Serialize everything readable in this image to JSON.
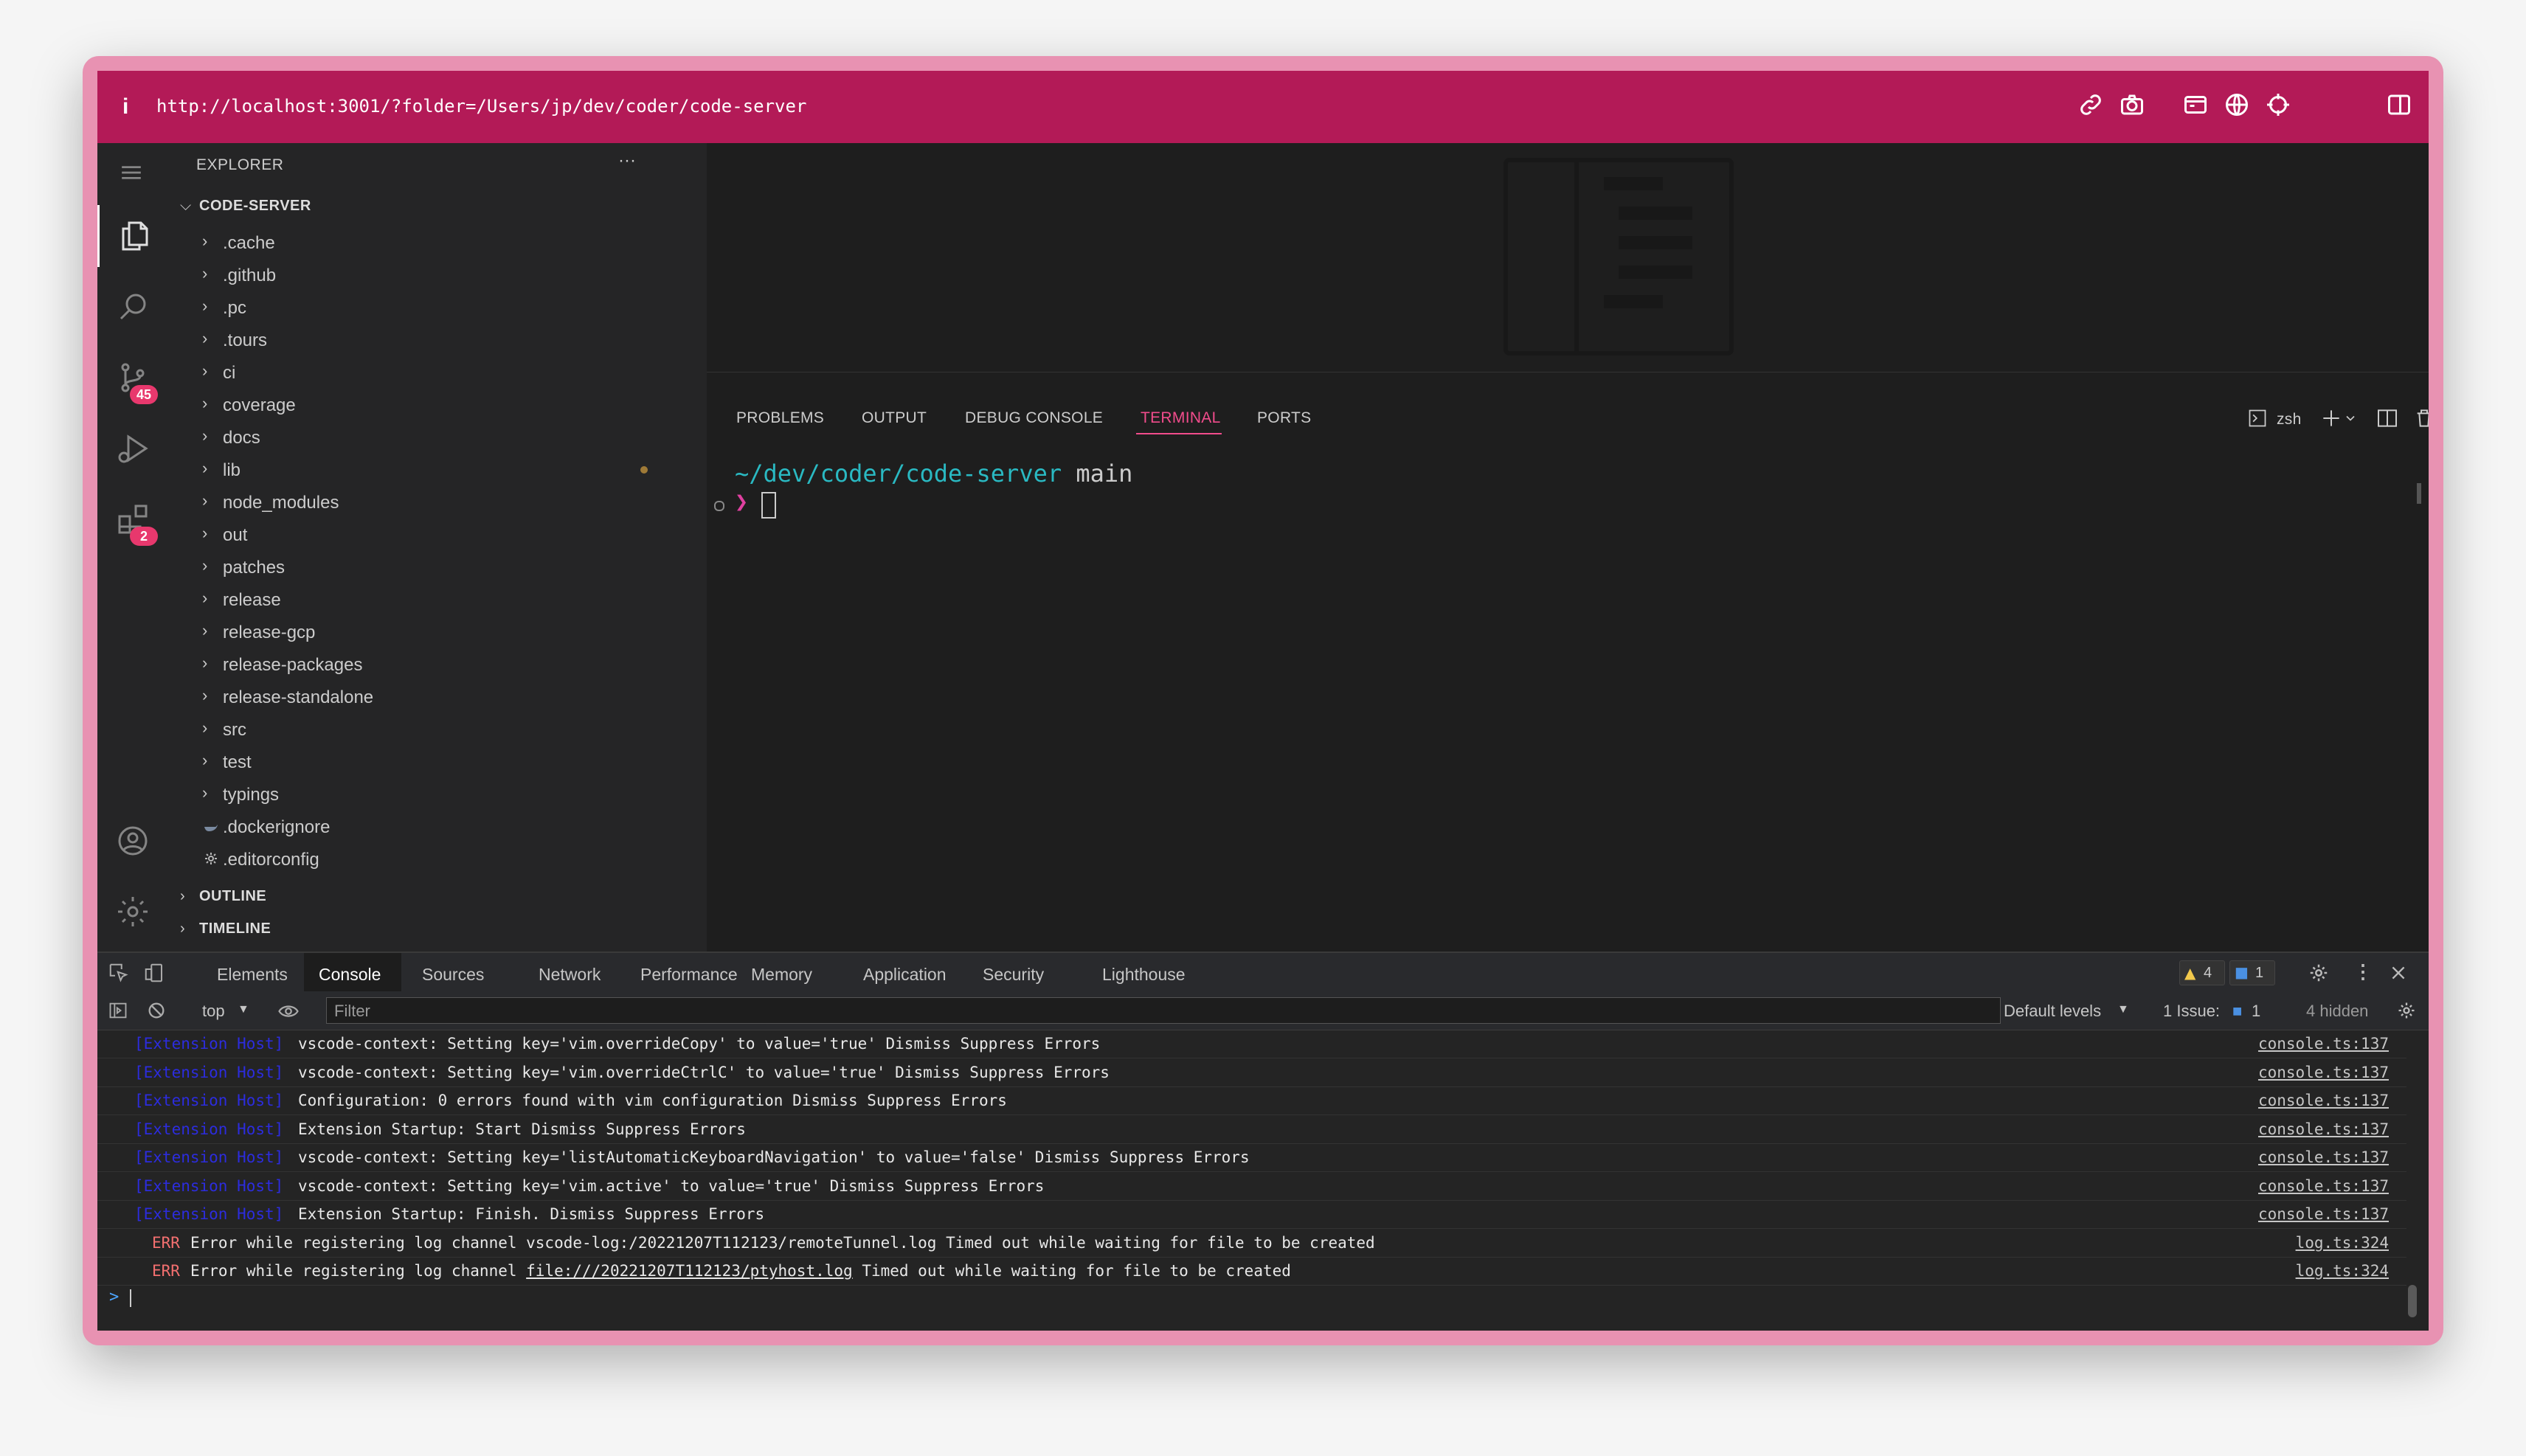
{
  "address_bar": {
    "info_icon": "i",
    "url": "http://localhost:3001/?folder=/Users/jp/dev/coder/code-server",
    "icons": [
      "link-icon",
      "camera-icon",
      "window-icon",
      "globe-icon",
      "crosshair-icon",
      "sidebar-icon"
    ]
  },
  "activity_bar": {
    "items": [
      "menu-icon",
      "files-icon",
      "search-icon",
      "source-control-icon",
      "run-debug-icon",
      "extensions-icon",
      "account-icon",
      "settings-gear-icon"
    ],
    "source_control_badge": "45",
    "extensions_badge": "2"
  },
  "explorer": {
    "title": "EXPLORER",
    "more": "···",
    "root": "CODE-SERVER",
    "folders": [
      ".cache",
      ".github",
      ".pc",
      ".tours",
      "ci",
      "coverage",
      "docs",
      "lib",
      "node_modules",
      "out",
      "patches",
      "release",
      "release-gcp",
      "release-packages",
      "release-standalone",
      "src",
      "test",
      "typings"
    ],
    "files": [
      ".dockerignore",
      ".editorconfig"
    ],
    "outline": "OUTLINE",
    "timeline": "TIMELINE"
  },
  "panel": {
    "tabs": [
      "PROBLEMS",
      "OUTPUT",
      "DEBUG CONSOLE",
      "TERMINAL",
      "PORTS"
    ],
    "active_tab": "TERMINAL",
    "shell": "zsh",
    "terminal": {
      "path": "~/dev/coder/code-server",
      "branch": "main",
      "prompt": "❯"
    }
  },
  "devtools": {
    "tabs": [
      "Elements",
      "Console",
      "Sources",
      "Network",
      "Performance",
      "Memory",
      "Application",
      "Security",
      "Lighthouse"
    ],
    "active_tab": "Console",
    "warnings": "4",
    "messages": "1",
    "context": "top",
    "filter_placeholder": "Filter",
    "levels": "Default levels",
    "issues_label": "1 Issue:",
    "issues_count": "1",
    "hidden": "4 hidden",
    "logs": [
      {
        "tag": "[Extension Host]",
        "msg": "vscode-context: Setting key='vim.overrideCopy' to value='true' Dismiss Suppress Errors",
        "src": "console.ts:137"
      },
      {
        "tag": "[Extension Host]",
        "msg": "vscode-context: Setting key='vim.overrideCtrlC' to value='true' Dismiss Suppress Errors",
        "src": "console.ts:137"
      },
      {
        "tag": "[Extension Host]",
        "msg": "Configuration: 0 errors found with vim configuration Dismiss Suppress Errors",
        "src": "console.ts:137"
      },
      {
        "tag": "[Extension Host]",
        "msg": "Extension Startup: Start Dismiss Suppress Errors",
        "src": "console.ts:137"
      },
      {
        "tag": "[Extension Host]",
        "msg": "vscode-context: Setting key='listAutomaticKeyboardNavigation' to value='false' Dismiss Suppress Errors",
        "src": "console.ts:137"
      },
      {
        "tag": "[Extension Host]",
        "msg": "vscode-context: Setting key='vim.active' to value='true' Dismiss Suppress Errors",
        "src": "console.ts:137"
      },
      {
        "tag": "[Extension Host]",
        "msg": "Extension Startup: Finish. Dismiss Suppress Errors",
        "src": "console.ts:137"
      }
    ],
    "errors": [
      {
        "label": "ERR",
        "msg_pre": "Error while registering log channel vscode-log:/20221207T112123/remoteTunnel.log Timed out while waiting for file to be created",
        "link": "",
        "msg_post": "",
        "src": "log.ts:324"
      },
      {
        "label": "ERR",
        "msg_pre": "Error while registering log channel ",
        "link": "file:///20221207T112123/ptyhost.log",
        "msg_post": " Timed out while waiting for file to be created",
        "src": "log.ts:324"
      }
    ],
    "console_prompt": ">"
  }
}
